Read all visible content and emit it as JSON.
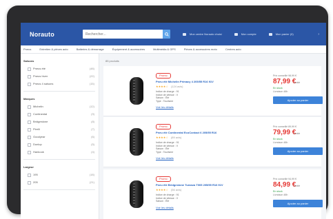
{
  "header": {
    "logo": "Norauto",
    "search_placeholder": "Rechercher...",
    "store": "Mon centre Norauto choisi",
    "account": "Mon compte",
    "cart": "Mon panier (0)",
    "accent": "#2b56a6"
  },
  "nav": {
    "items": [
      "Pneus",
      "Entretien & pièces auto",
      "Batteries & démarrage",
      "Équipement & accessoires",
      "Multimédia & GPS",
      "Pièces & accessoires moto",
      "Centres auto"
    ]
  },
  "sidebar": {
    "groups": [
      {
        "title": "Saisons",
        "count": "",
        "options": [
          {
            "label": "Pneus été",
            "count": "(48)"
          },
          {
            "label": "Pneus hiver",
            "count": "(22)"
          },
          {
            "label": "Pneus 4 saisons",
            "count": "(15)"
          }
        ]
      },
      {
        "title": "Marques",
        "count": "",
        "options": [
          {
            "label": "Michelin",
            "count": "(12)"
          },
          {
            "label": "Continental",
            "count": "(9)"
          },
          {
            "label": "Bridgestone",
            "count": "(8)"
          },
          {
            "label": "Pirelli",
            "count": "(7)"
          },
          {
            "label": "Goodyear",
            "count": "(6)"
          },
          {
            "label": "Dunlop",
            "count": "(5)"
          },
          {
            "label": "Hankook",
            "count": "(4)"
          }
        ]
      },
      {
        "title": "Largeur",
        "count": "",
        "options": [
          {
            "label": "195",
            "count": "(18)"
          },
          {
            "label": "205",
            "count": "(21)"
          }
        ]
      }
    ]
  },
  "results": {
    "summary": "85 produits",
    "items": [
      {
        "badge": "Promo",
        "title": "Pneu été Michelin Primacy 4 205/55 R16 91V",
        "rating": "★★★★☆",
        "reviews": "(124 avis)",
        "specs": [
          "Indice de charge : 91",
          "Indice de vitesse : V",
          "Saison : Été",
          "Type : Tourisme"
        ],
        "details": "Voir les détails",
        "old_price": "Prix conseillé 98,99 €",
        "price": "87,99 €",
        "unit": "l'unité",
        "stock": "En stock",
        "delivery": "Livraison 48h",
        "cta": "Ajouter au panier"
      },
      {
        "badge": "Promo",
        "title": "Pneu été Continental EcoContact 6 205/55 R16",
        "rating": "★★★★☆",
        "reviews": "(89 avis)",
        "specs": [
          "Indice de charge : 91",
          "Indice de vitesse : V",
          "Saison : Été",
          "Type : Tourisme"
        ],
        "details": "Voir les détails",
        "old_price": "Prix conseillé 89,99 €",
        "price": "79,99 €",
        "unit": "l'unité",
        "stock": "En stock",
        "delivery": "Livraison 48h",
        "cta": "Ajouter au panier"
      },
      {
        "badge": "Promo",
        "title": "Pneu été Bridgestone Turanza T005 205/55 R16 91V",
        "rating": "★★★★☆",
        "reviews": "(56 avis)",
        "specs": [
          "Indice de charge : 91",
          "Indice de vitesse : V",
          "Saison : Été"
        ],
        "details": "Voir les détails",
        "old_price": "Prix conseillé 94,99 €",
        "price": "84,99 €",
        "unit": "l'unité",
        "stock": "En stock",
        "delivery": "Livraison 48h",
        "cta": "Ajouter au panier"
      }
    ]
  }
}
